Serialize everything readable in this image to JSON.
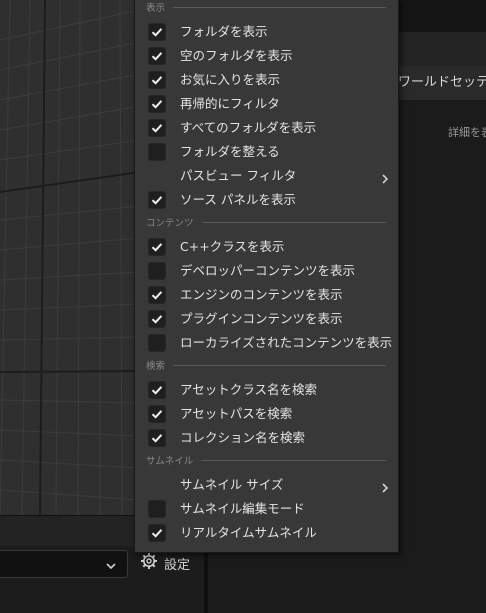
{
  "background": {
    "world_tab_label": "ワールドセッティ",
    "details_label": "詳細を表"
  },
  "content_browser": {
    "settings_label": "設定"
  },
  "menu": {
    "sections": [
      {
        "title": "表示"
      },
      {
        "title": "コンテンツ"
      },
      {
        "title": "検索"
      },
      {
        "title": "サムネイル"
      }
    ],
    "items": [
      {
        "label": "フォルダを表示",
        "checked": true
      },
      {
        "label": "空のフォルダを表示",
        "checked": true
      },
      {
        "label": "お気に入りを表示",
        "checked": true
      },
      {
        "label": "再帰的にフィルタ",
        "checked": true
      },
      {
        "label": "すべてのフォルダを表示",
        "checked": true
      },
      {
        "label": "フォルダを整える",
        "checked": false
      },
      {
        "label": "パスビュー フィルタ",
        "submenu": true
      },
      {
        "label": "ソース パネルを表示",
        "checked": true
      },
      {
        "label": "C++クラスを表示",
        "checked": true
      },
      {
        "label": "デベロッパーコンテンツを表示",
        "checked": false
      },
      {
        "label": "エンジンのコンテンツを表示",
        "checked": true
      },
      {
        "label": "プラグインコンテンツを表示",
        "checked": true
      },
      {
        "label": "ローカライズされたコンテンツを表示",
        "checked": false
      },
      {
        "label": "アセットクラス名を検索",
        "checked": true
      },
      {
        "label": "アセットパスを検索",
        "checked": true
      },
      {
        "label": "コレクション名を検索",
        "checked": true
      },
      {
        "label": "サムネイル サイズ",
        "submenu": true
      },
      {
        "label": "サムネイル編集モード",
        "checked": false
      },
      {
        "label": "リアルタイムサムネイル",
        "checked": true
      }
    ]
  }
}
